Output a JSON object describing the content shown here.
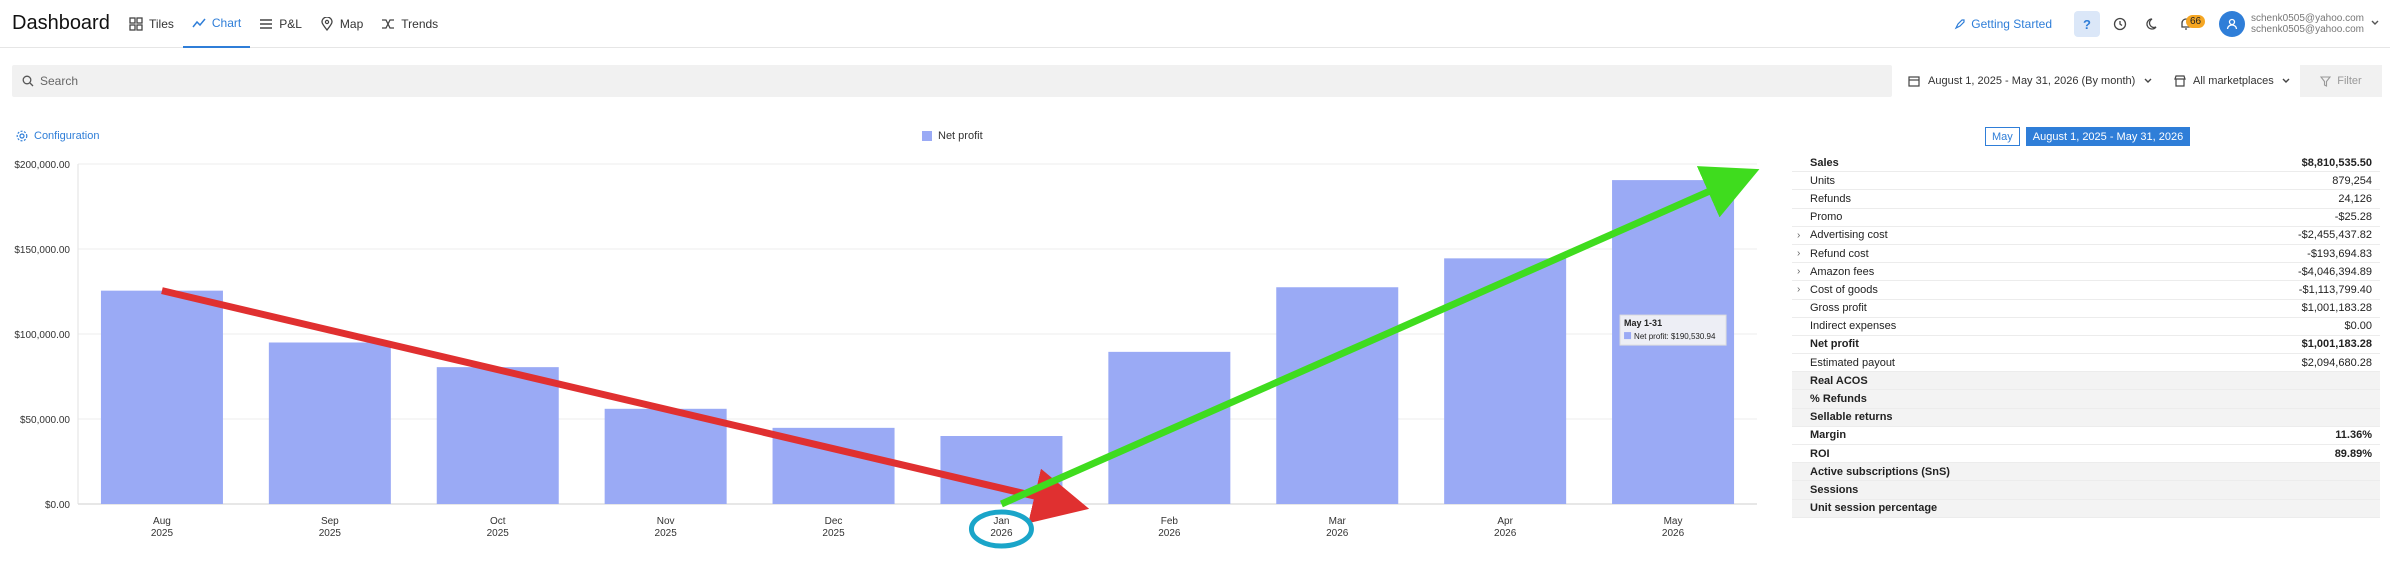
{
  "app": {
    "title": "Dashboard"
  },
  "nav": [
    {
      "label": "Tiles",
      "icon": "grid-icon"
    },
    {
      "label": "Chart",
      "icon": "chart-line-icon",
      "active": true
    },
    {
      "label": "P&L",
      "icon": "list-icon"
    },
    {
      "label": "Map",
      "icon": "map-pin-icon"
    },
    {
      "label": "Trends",
      "icon": "trends-icon"
    }
  ],
  "header": {
    "getting_started": "Getting Started",
    "help": "?",
    "notifications_count": "66",
    "emails": [
      "schenk0505@yahoo.com",
      "schenk0505@yahoo.com"
    ]
  },
  "search": {
    "placeholder": "Search"
  },
  "date_range": "August 1, 2025 - May 31, 2026 (By month)",
  "marketplaces": "All marketplaces",
  "filter_label": "Filter",
  "configuration_label": "Configuration",
  "colors": {
    "accent": "#2f7ed8",
    "bar": "#9aaaf5",
    "red_arrow": "#e03030",
    "green_arrow": "#3fdc1e",
    "circle": "#1aa5c9"
  },
  "chart_data": {
    "type": "bar",
    "categories": [
      [
        "Aug",
        "2025"
      ],
      [
        "Sep",
        "2025"
      ],
      [
        "Oct",
        "2025"
      ],
      [
        "Nov",
        "2025"
      ],
      [
        "Dec",
        "2025"
      ],
      [
        "Jan",
        "2026"
      ],
      [
        "Feb",
        "2026"
      ],
      [
        "Mar",
        "2026"
      ],
      [
        "Apr",
        "2026"
      ],
      [
        "May",
        "2026"
      ]
    ],
    "series": [
      {
        "name": "Net profit",
        "values": [
          125500,
          95000,
          80500,
          56000,
          44800,
          40000,
          89500,
          127500,
          144500,
          190530.94
        ]
      }
    ],
    "ylim": [
      0,
      200000
    ],
    "yticks": [
      "$0.00",
      "$50,000.00",
      "$100,000.00",
      "$150,000.00",
      "$200,000.00"
    ],
    "grid": true,
    "legend": "top-center",
    "tooltip": {
      "title": "May 1-31",
      "text": "Net profit: $190,530.94",
      "category_index": 9
    },
    "annotations": {
      "red_arrow": {
        "from": [
          0,
          125500
        ],
        "to": [
          5.4,
          0
        ]
      },
      "green_arrow": {
        "from": [
          5,
          0
        ],
        "to": [
          9.4,
          192000
        ]
      },
      "circled_category_index": 5
    }
  },
  "period_buttons": [
    {
      "label": "May",
      "active": false
    },
    {
      "label": "August 1, 2025 - May 31, 2026",
      "active": true
    }
  ],
  "metrics": [
    {
      "label": "Sales",
      "value": "$8,810,535.50",
      "bold": true
    },
    {
      "label": "Units",
      "value": "879,254"
    },
    {
      "label": "Refunds",
      "value": "24,126"
    },
    {
      "label": "Promo",
      "value": "-$25.28"
    },
    {
      "label": "Advertising cost",
      "value": "-$2,455,437.82",
      "expandable": true
    },
    {
      "label": "Refund cost",
      "value": "-$193,694.83",
      "expandable": true
    },
    {
      "label": "Amazon fees",
      "value": "-$4,046,394.89",
      "expandable": true
    },
    {
      "label": "Cost of goods",
      "value": "-$1,113,799.40",
      "expandable": true
    },
    {
      "label": "Gross profit",
      "value": "$1,001,183.28"
    },
    {
      "label": "Indirect expenses",
      "value": "$0.00"
    },
    {
      "label": "Net profit",
      "value": "$1,001,183.28",
      "bold": true
    },
    {
      "label": "Estimated payout",
      "value": "$2,094,680.28"
    },
    {
      "label": "Real ACOS",
      "value": "",
      "bold": true,
      "grey": true
    },
    {
      "label": "% Refunds",
      "value": "",
      "bold": true,
      "grey": true
    },
    {
      "label": "Sellable returns",
      "value": "",
      "bold": true,
      "grey": true
    },
    {
      "label": "Margin",
      "value": "11.36%",
      "bold": true
    },
    {
      "label": "ROI",
      "value": "89.89%",
      "bold": true
    },
    {
      "label": "Active subscriptions (SnS)",
      "value": "",
      "bold": true,
      "grey": true
    },
    {
      "label": "Sessions",
      "value": "",
      "bold": true,
      "grey": true
    },
    {
      "label": "Unit session percentage",
      "value": "",
      "bold": true,
      "grey": true
    }
  ]
}
